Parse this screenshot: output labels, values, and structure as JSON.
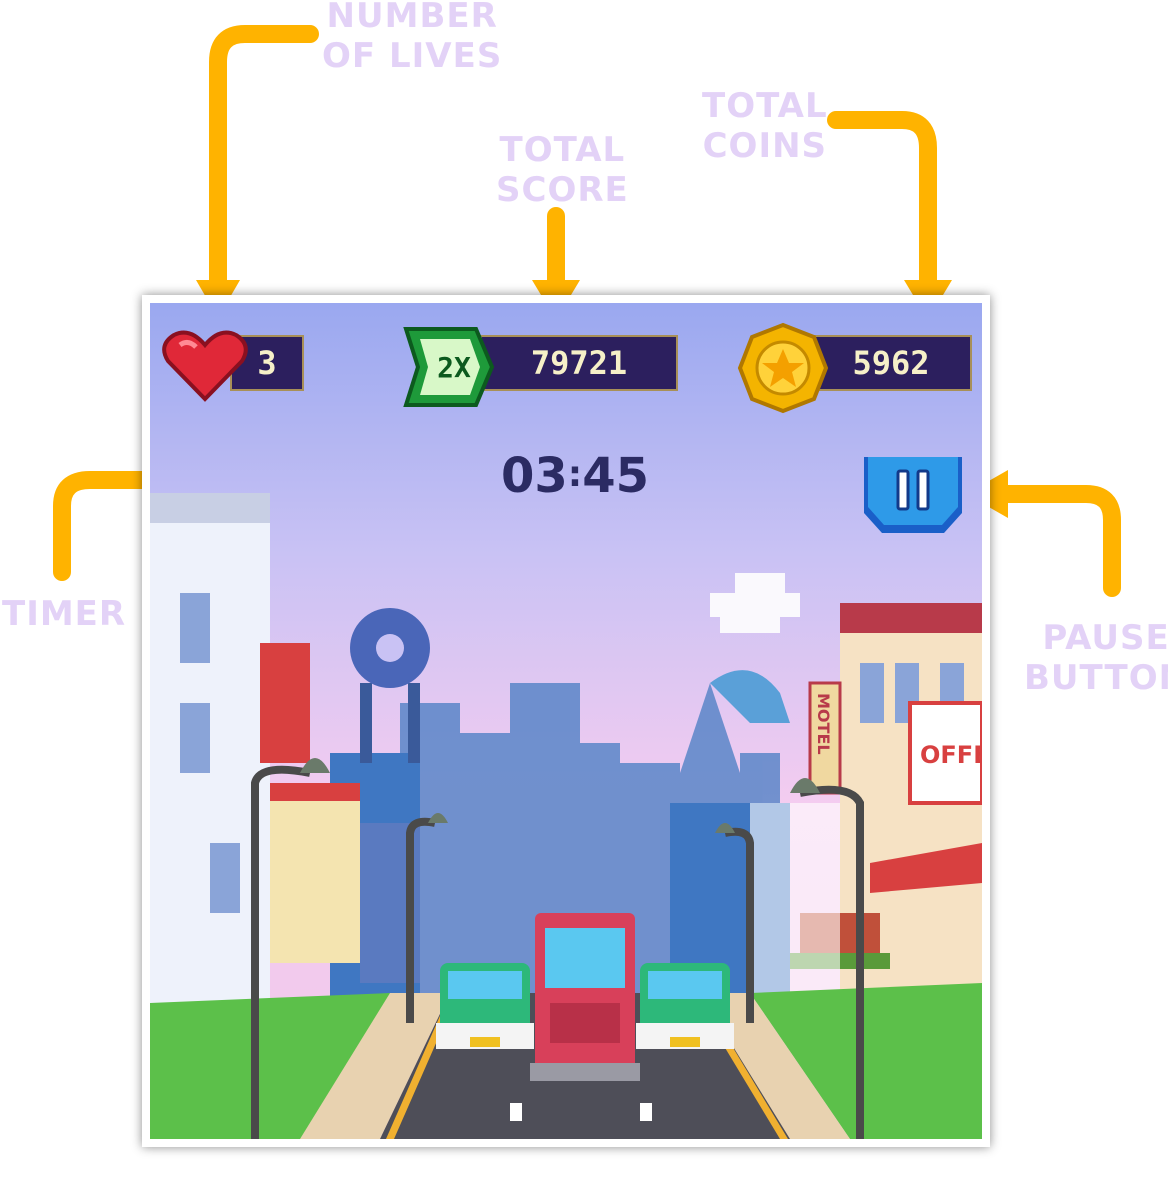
{
  "callouts": {
    "lives": "NUMBER\nOF LIVES",
    "score": "TOTAL\nSCORE",
    "coins": "TOTAL\nCOINS",
    "timer": "TIMER",
    "pause": "PAUSE\nBUTTON"
  },
  "hud": {
    "lives": "3",
    "multiplier": "2X",
    "score": "79721",
    "coins": "5962",
    "timer_minutes": "03",
    "timer_separator": ":",
    "timer_seconds": "45"
  },
  "scene": {
    "sign_motel": "MOTEL",
    "sign_offer": "OFFE"
  },
  "icons": [
    "heart-icon",
    "multiplier-badge-icon",
    "coin-icon",
    "pause-icon"
  ],
  "colors": {
    "callout_text": "#e3d2f7",
    "arrow": "#ffb300",
    "hud_panel": "#2c1f5e",
    "hud_text": "#f6f0c8",
    "timer_text": "#2b2b63",
    "pause_button": "#1e88e5"
  }
}
